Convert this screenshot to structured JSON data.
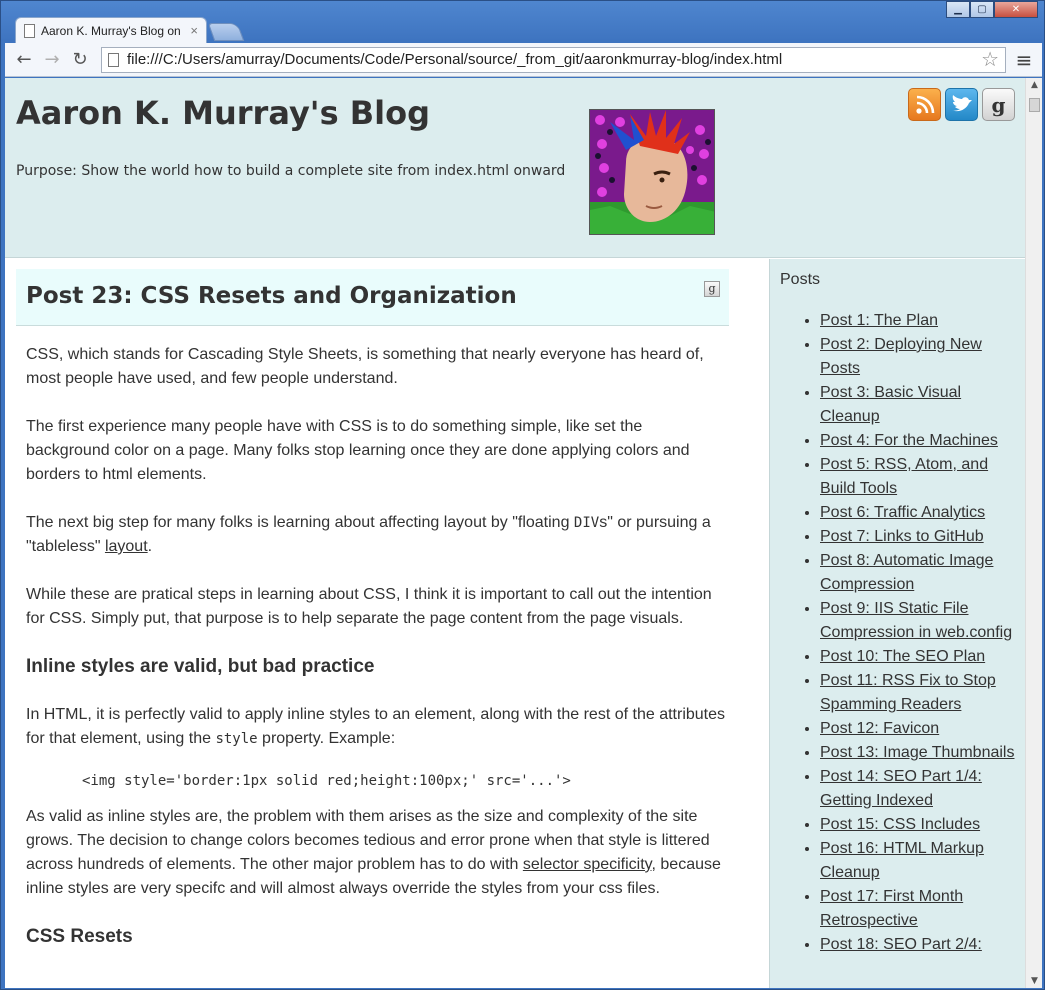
{
  "browser": {
    "tab_title": "Aaron K. Murray's Blog on",
    "tab_close": "×",
    "url": "file:///C:/Users/amurray/Documents/Code/Personal/source/_from_git/aaronkmurray-blog/index.html"
  },
  "header": {
    "title": "Aaron K. Murray's Blog",
    "purpose": "Purpose: Show the world how to build a complete site from index.html onward",
    "github_glyph": "g"
  },
  "post": {
    "title": "Post 23: CSS Resets and Organization",
    "github_glyph": "g",
    "p1": "CSS, which stands for Cascading Style Sheets, is something that nearly everyone has heard of, most people have used, and few people understand.",
    "p2": "The first experience many people have with CSS is to do something simple, like set the background color on a page. Many folks stop learning once they are done applying colors and borders to html elements.",
    "p3_a": "The next big step for many folks is learning about affecting layout by \"floating ",
    "p3_code": "DIV",
    "p3_b": "s\" or pursuing a \"tableless\" ",
    "p3_link": "layout",
    "p3_c": ".",
    "p4": "While these are pratical steps in learning about CSS, I think it is important to call out the intention for CSS. Simply put, that purpose is to help separate the page content from the page visuals.",
    "h_inline": "Inline styles are valid, but bad practice",
    "p5_a": "In HTML, it is perfectly valid to apply inline styles to an element, along with the rest of the attributes for that element, using the ",
    "p5_code": "style",
    "p5_b": " property. Example:",
    "code_example": "<img style='border:1px solid red;height:100px;' src='...'>",
    "p6_a": "As valid as inline styles are, the problem with them arises as the size and complexity of the site grows. The decision to change colors becomes tedious and error prone when that style is littered across hundreds of elements. The other major problem has to do with ",
    "p6_link": "selector specificity",
    "p6_b": ", because inline styles are very specifc and will almost always override the styles from your css files.",
    "h_reset": "CSS Resets"
  },
  "sidebar": {
    "title": "Posts",
    "items": [
      "Post 1: The Plan",
      "Post 2: Deploying New Posts",
      "Post 3: Basic Visual Cleanup",
      "Post 4: For the Machines",
      "Post 5: RSS, Atom, and Build Tools",
      "Post 6: Traffic Analytics",
      "Post 7: Links to GitHub",
      "Post 8: Automatic Image Compression",
      "Post 9: IIS Static File Compression in web.config",
      "Post 10: The SEO Plan",
      "Post 11: RSS Fix to Stop Spamming Readers",
      "Post 12: Favicon",
      "Post 13: Image Thumbnails",
      "Post 14: SEO Part 1/4: Getting Indexed",
      "Post 15: CSS Includes",
      "Post 16: HTML Markup Cleanup",
      "Post 17: First Month Retrospective",
      "Post 18: SEO Part 2/4:"
    ]
  },
  "colors": {
    "header_bg": "#dcedee",
    "post_head_bg": "#e9fcfc",
    "text": "#333333"
  }
}
